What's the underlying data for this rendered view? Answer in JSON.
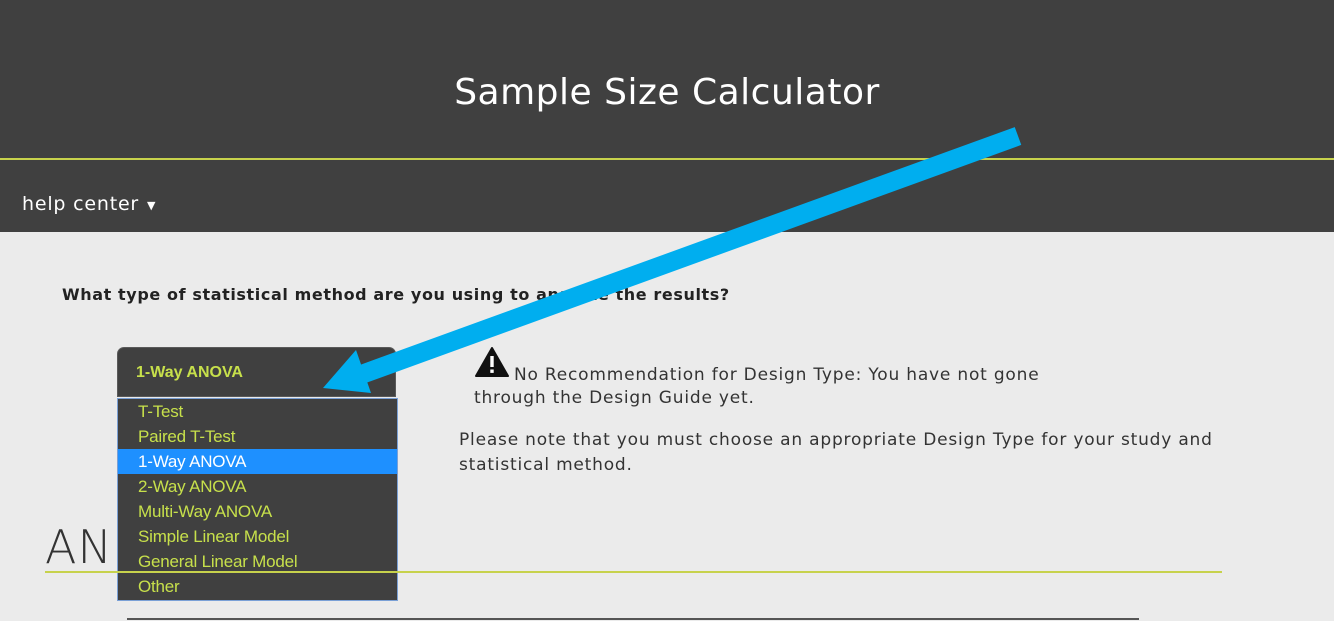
{
  "header": {
    "title": "Sample Size Calculator"
  },
  "nav": {
    "help_center": "help center",
    "caret": "▼"
  },
  "question": {
    "text": "What type of statistical method are you using to analyze the results?"
  },
  "method_select": {
    "value": "1-Way ANOVA",
    "arrow": "▼",
    "options": [
      "T-Test",
      "Paired T-Test",
      "1-Way ANOVA",
      "2-Way ANOVA",
      "Multi-Way ANOVA",
      "Simple Linear Model",
      "General Linear Model",
      "Other"
    ],
    "highlighted_option": "1-Way ANOVA"
  },
  "recommendation": {
    "line1": "No Recommendation for Design Type: You have not gone",
    "line2": "through the Design Guide yet.",
    "note": "Please note that you must choose an appropriate Design Type for your study and statistical method."
  },
  "section": {
    "heading": "AN"
  },
  "colors": {
    "banner_bg": "#404040",
    "accent_line": "#c7d24c",
    "option_text": "#c7e04b",
    "highlight": "#1e90ff",
    "annotation_arrow": "#00aeef",
    "page_bg": "#ebebeb"
  },
  "icons": {
    "warning": "warning-triangle-icon",
    "pointer": "annotation-arrow"
  }
}
